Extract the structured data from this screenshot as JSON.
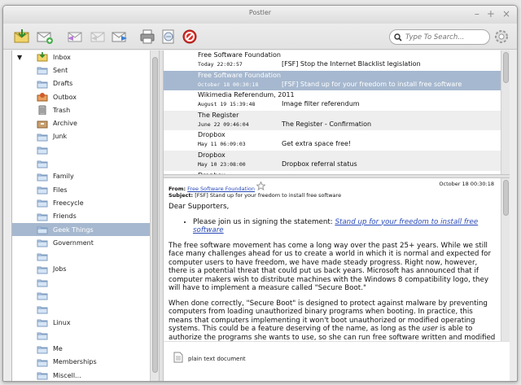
{
  "window": {
    "title": "Postler"
  },
  "titlebar_buttons": {
    "minimize": "–",
    "maximize": "+",
    "close": "×"
  },
  "toolbar": {
    "buttons": [
      "receive-mail",
      "compose",
      "reply",
      "reply-all",
      "forward",
      "print",
      "show-source",
      "delete"
    ]
  },
  "search": {
    "placeholder": "Type To Search..."
  },
  "sidebar": {
    "items": [
      {
        "label": "Inbox",
        "icon": "inbox-icon",
        "expander": "▼"
      },
      {
        "label": "Sent",
        "icon": "sent-folder-icon"
      },
      {
        "label": "Drafts",
        "icon": "drafts-folder-icon"
      },
      {
        "label": "Outbox",
        "icon": "outbox-icon"
      },
      {
        "label": "Trash",
        "icon": "trash-icon"
      },
      {
        "label": "Archive",
        "icon": "archive-icon"
      },
      {
        "label": "Junk",
        "icon": "junk-folder-icon"
      },
      {
        "label": "",
        "icon": "folder-icon"
      },
      {
        "label": "",
        "icon": "folder-icon"
      },
      {
        "label": "Family",
        "icon": "folder-icon"
      },
      {
        "label": "Files",
        "icon": "folder-icon"
      },
      {
        "label": "Freecycle",
        "icon": "folder-icon"
      },
      {
        "label": "Friends",
        "icon": "folder-icon"
      },
      {
        "label": "Geek Things",
        "icon": "folder-icon",
        "selected": true
      },
      {
        "label": "Government",
        "icon": "folder-icon"
      },
      {
        "label": "",
        "icon": "folder-icon"
      },
      {
        "label": "Jobs",
        "icon": "folder-icon"
      },
      {
        "label": "",
        "icon": "folder-icon"
      },
      {
        "label": "",
        "icon": "folder-icon"
      },
      {
        "label": "",
        "icon": "folder-icon"
      },
      {
        "label": "Linux",
        "icon": "folder-icon"
      },
      {
        "label": "",
        "icon": "folder-icon"
      },
      {
        "label": "Me",
        "icon": "folder-icon"
      },
      {
        "label": "Memberships",
        "icon": "folder-icon"
      },
      {
        "label": "Miscell...",
        "icon": "folder-icon"
      }
    ]
  },
  "message_list": [
    {
      "sender": "Free Software Foundation",
      "date": "Today 22:02:57",
      "subject": "[FSF] Stop the Internet Blacklist legislation"
    },
    {
      "sender": "Free Software Foundation",
      "date": "October 18 00:30:18",
      "subject": "[FSF] Stand up for your freedom to install free software",
      "selected": true
    },
    {
      "sender": "Wikimedia Referendum, 2011",
      "date": "August 19 15:39:48",
      "subject": "Image filter referendum"
    },
    {
      "sender": "The Register",
      "date": "June 22 09:46:04",
      "subject": "The Register - Confirmation"
    },
    {
      "sender": "Dropbox",
      "date": "May 11 06:09:03",
      "subject": "Get extra space free!"
    },
    {
      "sender": "Dropbox",
      "date": "May 10 23:08:00",
      "subject": "Dropbox referral status"
    },
    {
      "sender": "Dropbox",
      "date": "",
      "subject": ""
    }
  ],
  "message": {
    "from_label": "From:",
    "from_value": "Free Software Foundation",
    "subject_label": "Subject:",
    "subject_value": "[FSF] Stand up for your freedom to install free software",
    "date": "October 18 00:30:18",
    "greeting": "Dear Supporters,",
    "bullet_text": "Please join us in signing the statement: ",
    "bullet_link": "Stand up for your freedom to install free software",
    "para1": "The free software movement has come a long way over the past 25+ years. While we still face many challenges ahead for us to create a world in which it is normal and expected for computer users to have freedom, we have made steady progress. Right now, however, there is a potential threat that could put us back years. Microsoft has announced that if computer makers wish to distribute machines with the Windows 8 compatibility logo, they will have to implement a measure called \"Secure Boot.\"",
    "para2_a": "When done correctly, \"Secure Boot\" is designed to protect against malware by preventing computers from loading unauthorized binary programs when booting. In practice, this means that computers implementing it won't boot unauthorized or modified operating systems. This could be a feature deserving of the name, as long as the ",
    "para2_em": "user",
    "para2_b": " is able to authorize the programs she wants to use, so she can run free software written and modified"
  },
  "attachment": {
    "label": "plain text document"
  },
  "colors": {
    "selection": "#a6b8cf",
    "link": "#2a4ab8"
  }
}
